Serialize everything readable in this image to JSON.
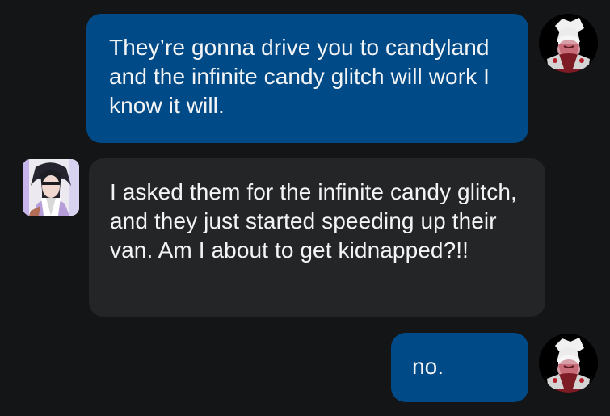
{
  "conversation": {
    "messages": [
      {
        "direction": "sent",
        "text": "They’re gonna drive you to candyland and the infinite candy glitch will work I know it will.",
        "avatar_icon": "white-haired-character-avatar-icon"
      },
      {
        "direction": "received",
        "text": "I asked them for the infinite candy glitch, and they just started speeding up their van. Am I about to get kidnapped?!!",
        "avatar_icon": "dark-haired-character-avatar-icon"
      },
      {
        "direction": "sent",
        "text": "no.",
        "avatar_icon": "white-haired-character-avatar-icon"
      }
    ]
  },
  "theme": {
    "background": "#141517",
    "sent_bubble": "#004b87",
    "received_bubble": "#242527",
    "text": "#f3f4f6"
  }
}
